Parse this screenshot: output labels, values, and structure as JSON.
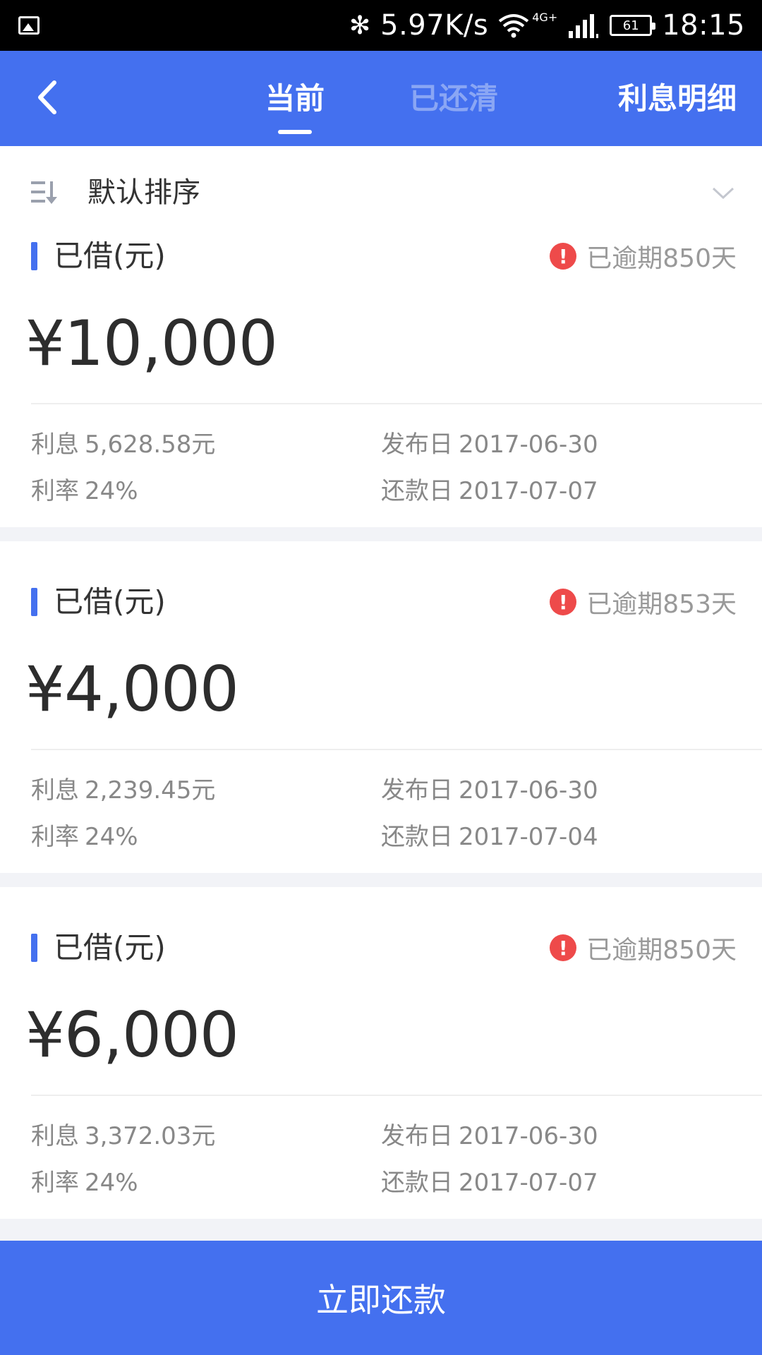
{
  "status_bar": {
    "speed": "5.97K/s",
    "network": "4G+",
    "battery": "61",
    "time": "18:15",
    "icons": [
      "gallery-icon",
      "bluetooth-icon",
      "wifi-icon",
      "signal-icon",
      "battery-icon"
    ]
  },
  "header": {
    "tabs": [
      {
        "label": "当前",
        "active": true
      },
      {
        "label": "已还清",
        "active": false
      }
    ],
    "right_link": "利息明细",
    "accent_color": "#4470ef"
  },
  "sort": {
    "label": "默认排序"
  },
  "loans": [
    {
      "borrowed_label": "已借(元)",
      "overdue": "已逾期850天",
      "amount": "¥10,000",
      "interest_label": "利息",
      "interest": "5,628.58元",
      "rate_label": "利率",
      "rate": "24%",
      "publish_label": "发布日",
      "publish_date": "2017-06-30",
      "repay_label": "还款日",
      "repay_date": "2017-07-07"
    },
    {
      "borrowed_label": "已借(元)",
      "overdue": "已逾期853天",
      "amount": "¥4,000",
      "interest_label": "利息",
      "interest": "2,239.45元",
      "rate_label": "利率",
      "rate": "24%",
      "publish_label": "发布日",
      "publish_date": "2017-06-30",
      "repay_label": "还款日",
      "repay_date": "2017-07-04"
    },
    {
      "borrowed_label": "已借(元)",
      "overdue": "已逾期850天",
      "amount": "¥6,000",
      "interest_label": "利息",
      "interest": "3,372.03元",
      "rate_label": "利率",
      "rate": "24%",
      "publish_label": "发布日",
      "publish_date": "2017-06-30",
      "repay_label": "还款日",
      "repay_date": "2017-07-07"
    }
  ],
  "footer": {
    "repay_button": "立即还款"
  }
}
